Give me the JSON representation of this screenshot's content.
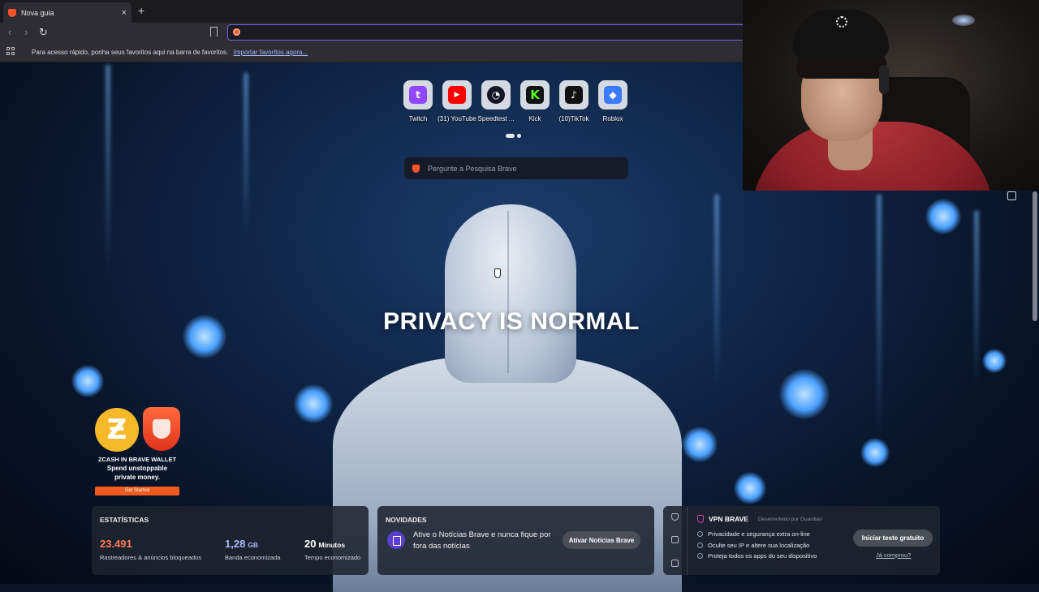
{
  "browser": {
    "tab": {
      "title": "Nova guia",
      "close_glyph": "×"
    },
    "new_tab_glyph": "+",
    "address_bar": {
      "value": ""
    },
    "bookmarks_bar": {
      "hint": "Para acesso rápido, ponha seus favoritos aqui na barra de favoritos.",
      "import_link": "Importar favoritos agora..."
    }
  },
  "speed_dial": {
    "tiles": [
      {
        "label": "Twitch",
        "icon": "twitch-icon",
        "color": "#9146ff",
        "glyph": "t"
      },
      {
        "label": "(31) YouTube",
        "icon": "youtube-icon",
        "color": "#ff0000",
        "glyph": "▶"
      },
      {
        "label": "Speedtest ...",
        "icon": "speedtest-icon",
        "color": "#141526",
        "glyph": "◔"
      },
      {
        "label": "Kick",
        "icon": "kick-icon",
        "color": "#53fc18",
        "glyph": "K"
      },
      {
        "label": "(10)TikTok",
        "icon": "tiktok-icon",
        "color": "#111111",
        "glyph": "♪"
      },
      {
        "label": "Roblox",
        "icon": "roblox-icon",
        "color": "#3b7bff",
        "glyph": "◆"
      }
    ],
    "pages": 2,
    "active_page": 1
  },
  "search": {
    "placeholder": "Pergunte a Pesquisa Brave"
  },
  "hero": {
    "headline": "PRIVACY IS NORMAL"
  },
  "promo": {
    "title": "ZCASH IN BRAVE WALLET",
    "line1": "Spend unstoppable",
    "line2": "private money.",
    "button": "Get Started",
    "coin_glyph": "Ƶ"
  },
  "stats_card": {
    "title": "ESTATÍSTICAS",
    "items": [
      {
        "value": "23.491",
        "unit": "",
        "label": "Rastreadores & anúncios bloqueados",
        "color": "#ff7a55"
      },
      {
        "value": "1,28",
        "unit": "GB",
        "label": "Banda economizada",
        "color": "#a9b8ff"
      },
      {
        "value": "20",
        "unit": "Minutos",
        "label": "Tempo economizado",
        "color": "#ffffff"
      }
    ]
  },
  "news_card": {
    "title": "NOVIDADES",
    "text": "Ative o Notícias Brave e nunca fique por fora das notícias",
    "button": "Ativar Notícias Brave"
  },
  "vpn_card": {
    "title": "VPN BRAVE",
    "by": "Desenvolvido por  Guardian",
    "features": [
      "Privacidade e segurança extra on-line",
      "Oculte seu IP e altere sua localização",
      "Proteja todos os apps do seu dispositivo"
    ],
    "button": "Iniciar teste gratuito",
    "link": "Já comprou?"
  },
  "colors": {
    "accent": "#7b5cf0",
    "brave_orange": "#fb542b"
  }
}
